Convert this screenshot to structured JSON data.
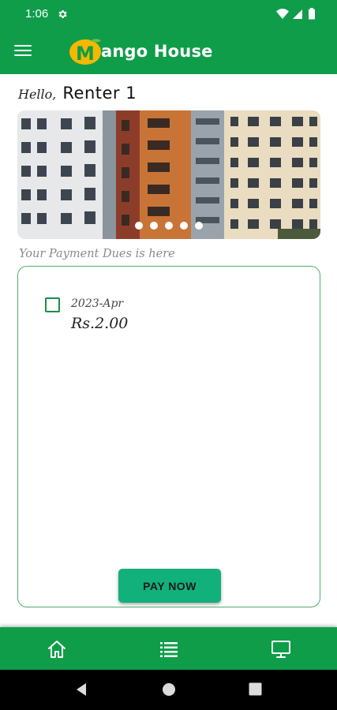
{
  "status_bar": {
    "time": "1:06",
    "icons": [
      "gear-icon",
      "wifi-icon",
      "signal-icon",
      "battery-icon"
    ]
  },
  "app_bar": {
    "logo_letter": "M",
    "title": "ango House",
    "menu_icon": "hamburger-menu-icon"
  },
  "greeting": {
    "hello": "Hello,",
    "name": "Renter 1"
  },
  "banner": {
    "image": "apartment-buildings-photo",
    "slide_count": 5
  },
  "dues": {
    "caption": "Your Payment Dues is here",
    "items": [
      {
        "month": "2023-Apr",
        "amount": "Rs.2.00",
        "checked": false
      }
    ],
    "pay_button": "PAY NOW"
  },
  "bottom_nav": {
    "items": [
      "home-icon",
      "list-icon",
      "monitor-icon"
    ]
  },
  "system_nav": {
    "items": [
      "back-icon",
      "home-circle-icon",
      "recents-icon"
    ]
  },
  "colors": {
    "primary_green": "#0f9d49",
    "pay_button": "#12b07a",
    "card_border": "#4eae6a",
    "logo_yellow": "#f5b800"
  }
}
